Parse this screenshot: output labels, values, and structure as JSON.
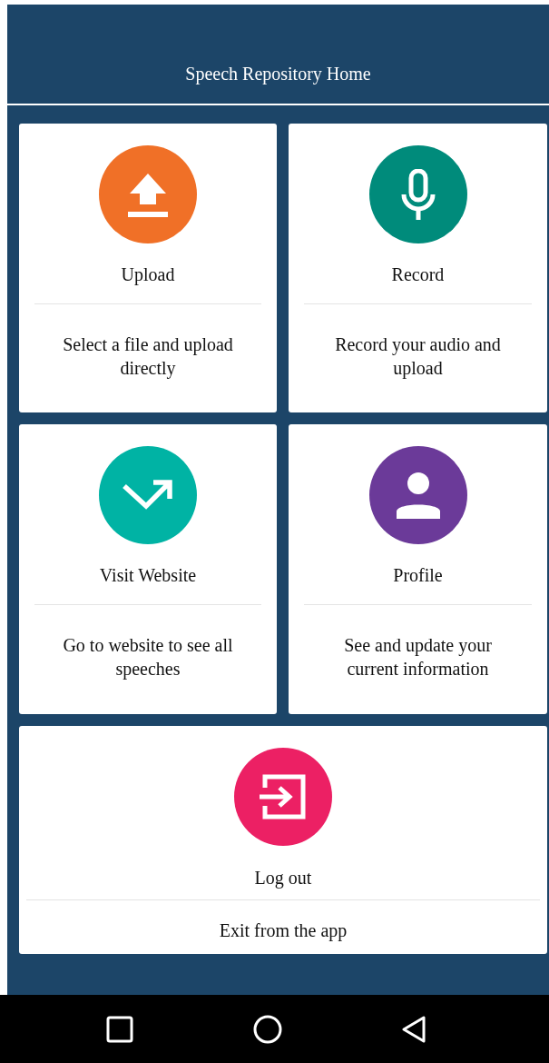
{
  "header": {
    "title": "Speech Repository Home"
  },
  "tiles": [
    {
      "kind": "upload",
      "color": "#f07027",
      "title": "Upload",
      "description": "Select a file and upload directly"
    },
    {
      "kind": "microphone",
      "color": "#008b7b",
      "title": "Record",
      "description": "Record your audio and upload"
    },
    {
      "kind": "arrow",
      "color": "#00b3a4",
      "title": "Visit Website",
      "description": "Go to website to see all speeches"
    },
    {
      "kind": "person",
      "color": "#6b3a99",
      "title": "Profile",
      "description": "See and update your current information"
    },
    {
      "kind": "exit",
      "color": "#ec2064",
      "title": "Log out",
      "description": "Exit from the app"
    }
  ]
}
